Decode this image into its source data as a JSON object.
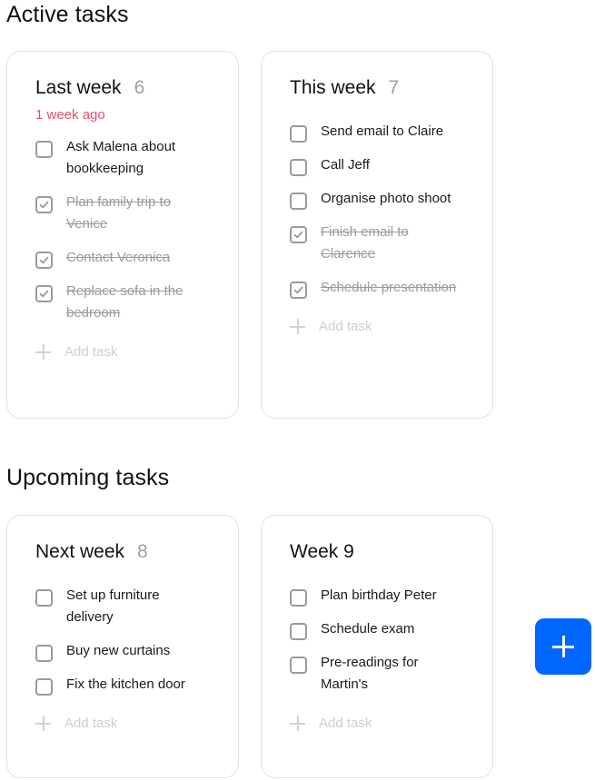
{
  "sections": {
    "active": {
      "title": "Active tasks"
    },
    "upcoming": {
      "title": "Upcoming tasks"
    }
  },
  "cards": {
    "last_week": {
      "title": "Last week",
      "count": "6",
      "subtitle": "1 week ago",
      "subtitle_color": "#e0506f",
      "tasks": [
        {
          "label": "Ask Malena about bookkeeping",
          "done": false
        },
        {
          "label": "Plan family trip to Venice",
          "done": true
        },
        {
          "label": "Contact Veronica",
          "done": true
        },
        {
          "label": "Replace sofa in the bedroom",
          "done": true
        }
      ],
      "add_label": "Add task"
    },
    "this_week": {
      "title": "This week",
      "count": "7",
      "tasks": [
        {
          "label": "Send email to Claire",
          "done": false
        },
        {
          "label": "Call Jeff",
          "done": false
        },
        {
          "label": "Organise photo shoot",
          "done": false
        },
        {
          "label": "Finish email to Clarence",
          "done": true
        },
        {
          "label": "Schedule presentation",
          "done": true
        }
      ],
      "add_label": "Add task"
    },
    "next_week": {
      "title": "Next week",
      "count": "8",
      "tasks": [
        {
          "label": "Set up furniture delivery",
          "done": false
        },
        {
          "label": "Buy new curtains",
          "done": false
        },
        {
          "label": "Fix the kitchen door",
          "done": false
        }
      ],
      "add_label": "Add task"
    },
    "week_9": {
      "title": "Week 9",
      "tasks": [
        {
          "label": "Plan birthday Peter",
          "done": false
        },
        {
          "label": "Schedule exam",
          "done": false
        },
        {
          "label": "Pre-readings for Martin's",
          "done": false
        }
      ],
      "add_label": "Add task"
    }
  },
  "fab": {
    "icon": "plus-icon",
    "color": "#0066ff"
  },
  "icons": {
    "checkbox_checked": "check-icon",
    "add": "plus-icon"
  }
}
